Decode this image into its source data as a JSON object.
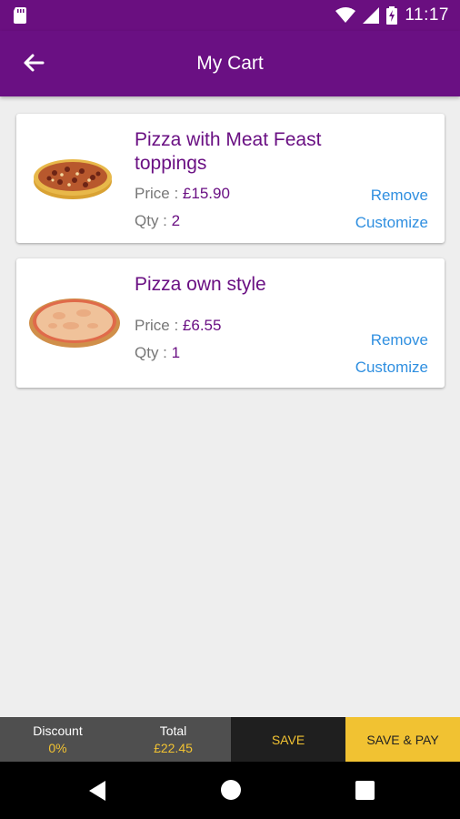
{
  "status_bar": {
    "time": "11:17"
  },
  "header": {
    "title": "My Cart"
  },
  "cart": {
    "items": [
      {
        "name": "Pizza with Meat Feast toppings",
        "price_label": "Price : ",
        "price": "£15.90",
        "qty_label": "Qty : ",
        "qty": "2",
        "remove_label": "Remove",
        "customize_label": "Customize",
        "image": "meat-feast-pizza"
      },
      {
        "name": "Pizza own style",
        "price_label": "Price : ",
        "price": "£6.55",
        "qty_label": "Qty : ",
        "qty": "1",
        "remove_label": "Remove",
        "customize_label": "Customize",
        "image": "cheese-pizza"
      }
    ]
  },
  "footer": {
    "discount_label": "Discount",
    "discount_value": "0%",
    "total_label": "Total",
    "total_value": "£22.45",
    "save_label": "SAVE",
    "save_pay_label": "SAVE & PAY"
  },
  "colors": {
    "primary": "#6a1083",
    "link": "#2f8fe0",
    "accent": "#f1c232"
  }
}
